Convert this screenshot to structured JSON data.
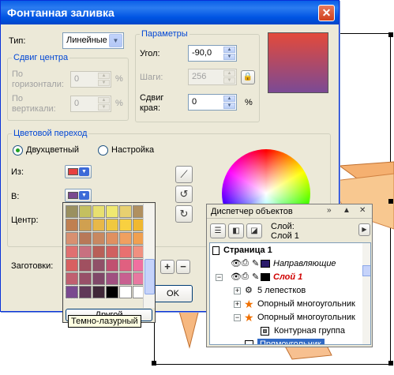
{
  "dialog": {
    "title": "Фонтанная заливка",
    "type_label": "Тип:",
    "type_value": "Линейные",
    "center_shift": {
      "title": "Сдвиг центра",
      "horizontal_label_1": "По",
      "horizontal_label_2": "горизонтали:",
      "horizontal_value": "0",
      "vertical_label_1": "По",
      "vertical_label_2": "вертикали:",
      "vertical_value": "0",
      "unit": "%"
    },
    "params": {
      "title": "Параметры",
      "angle_label": "Угол:",
      "angle_value": "-90,0",
      "steps_label": "Шаги:",
      "steps_value": "256",
      "edge_label_1": "Сдвиг",
      "edge_label_2": "края:",
      "edge_value": "0",
      "unit": "%"
    },
    "transition": {
      "title": "Цветовой переход",
      "two_color_label": "Двухцветный",
      "custom_label": "Настройка",
      "from_label": "Из:",
      "from_color": "#e84040",
      "to_label": "В:",
      "to_color": "#7a4a90",
      "center_label": "Центр:"
    },
    "presets_label": "Заготовки:",
    "ok_label": "OK"
  },
  "palette": {
    "colors": [
      "#9a9060",
      "#c4c060",
      "#e8e070",
      "#f0e870",
      "#e8d070",
      "#b09060",
      "#c08050",
      "#d0a050",
      "#e8b848",
      "#f0c840",
      "#f8d040",
      "#f0b830",
      "#d89070",
      "#b87858",
      "#c88860",
      "#e09060",
      "#f0a060",
      "#f0a050",
      "#e07070",
      "#c87080",
      "#b86058",
      "#d06060",
      "#e87070",
      "#f09080",
      "#d86060",
      "#a05060",
      "#905068",
      "#c05070",
      "#e06080",
      "#f070a0",
      "#c06070",
      "#985068",
      "#804868",
      "#a05080",
      "#c86090",
      "#e878a0",
      "#7a4a90",
      "#603858",
      "#402838",
      "#000000",
      "#ffffff",
      "#ffffff"
    ],
    "other_label": "Другой",
    "tooltip": "Темно-лазурный"
  },
  "object_manager": {
    "title": "Диспетчер объектов",
    "layer_info_1": "Слой:",
    "layer_info_2": "Слой 1",
    "tree": [
      {
        "label": "Страница 1"
      },
      {
        "label": "Направляющие"
      },
      {
        "label": "Слой 1"
      },
      {
        "label": "5 лепестков"
      },
      {
        "label": "Опорный многоугольник"
      },
      {
        "label": "Опорный многоугольник"
      },
      {
        "label": "Контурная группа"
      },
      {
        "label": "Прямоугольник"
      }
    ]
  }
}
